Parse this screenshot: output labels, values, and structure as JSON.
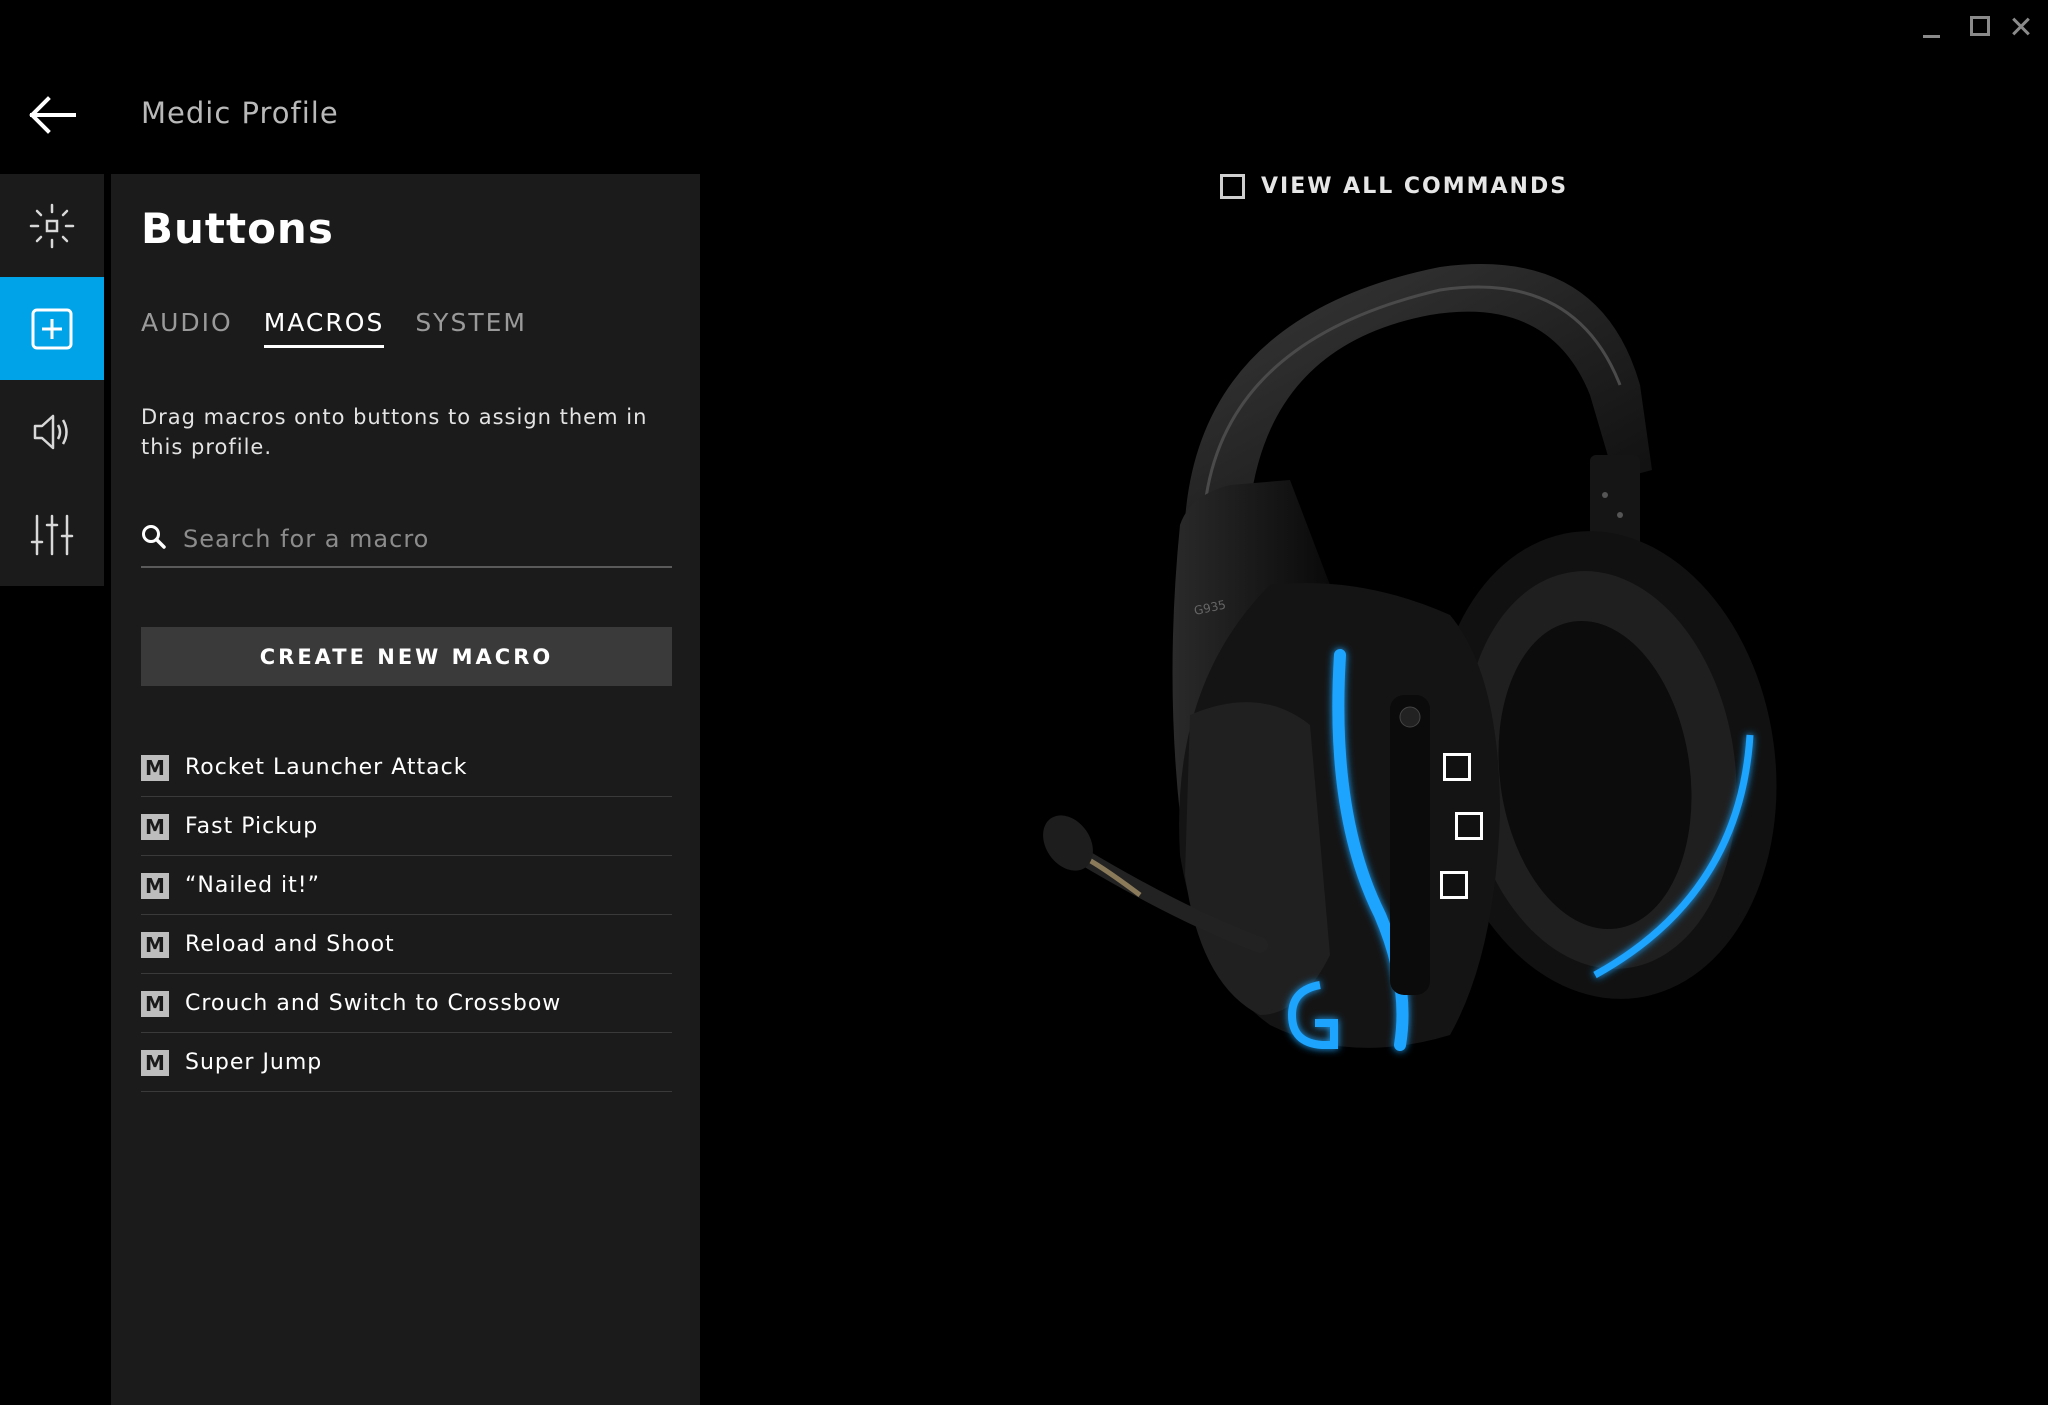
{
  "window": {
    "controls": [
      "minimize-icon",
      "maximize-icon",
      "close-icon"
    ]
  },
  "header": {
    "back_icon": "arrow-left-icon",
    "profile_title": "Medic Profile"
  },
  "sidebar": {
    "items": [
      {
        "name": "lighting",
        "icon": "brightness-icon",
        "active": false
      },
      {
        "name": "assignments",
        "icon": "plus-square-icon",
        "active": true
      },
      {
        "name": "audio",
        "icon": "speaker-icon",
        "active": false
      },
      {
        "name": "equalizer",
        "icon": "equalizer-icon",
        "active": false
      }
    ],
    "accent_color": "#00a3e8"
  },
  "panel": {
    "title": "Buttons",
    "tabs": [
      {
        "label": "AUDIO",
        "active": false
      },
      {
        "label": "MACROS",
        "active": true
      },
      {
        "label": "SYSTEM",
        "active": false
      }
    ],
    "hint": "Drag macros onto buttons to assign them in this profile.",
    "search": {
      "placeholder": "Search for a macro",
      "value": ""
    },
    "create_button": "CREATE NEW MACRO",
    "macro_badge": "M",
    "macros": [
      "Rocket Launcher Attack",
      "Fast Pickup",
      "“Nailed it!”",
      "Reload and Shoot",
      "Crouch and Switch to Crossbow",
      "Super Jump"
    ]
  },
  "device": {
    "view_all_label": "VIEW ALL COMMANDS",
    "view_all_checked": false,
    "model_label": "G935",
    "led_color": "#1ea4ff"
  }
}
